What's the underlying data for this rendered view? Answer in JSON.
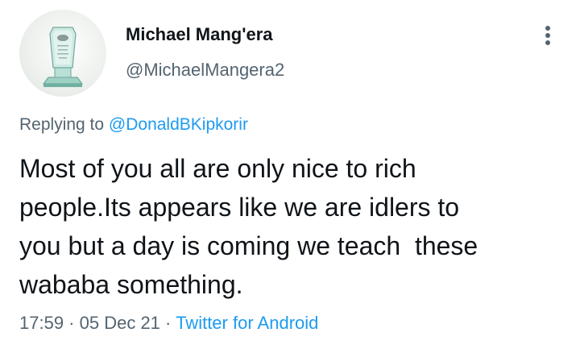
{
  "user": {
    "avatar_icon": "glass-award-trophy-avatar",
    "display_name": "Michael Mang'era",
    "handle": "@MichaelMangera2"
  },
  "menu": {
    "icon": "more-vertical-icon"
  },
  "reply": {
    "prefix": "Replying to ",
    "mention": "@DonaldBKipkorir"
  },
  "tweet": {
    "lines": [
      "Most of you all are only nice to rich",
      "people.Its appears like we are idlers to",
      "you but a day is coming we teach  these",
      "wababa something."
    ]
  },
  "meta": {
    "time": "17:59",
    "sep1": " · ",
    "date": "05 Dec 21",
    "sep2": " · ",
    "source": "Twitter for Android"
  },
  "colors": {
    "text": "#0f1419",
    "secondary": "#536471",
    "link": "#1d9bf0"
  }
}
